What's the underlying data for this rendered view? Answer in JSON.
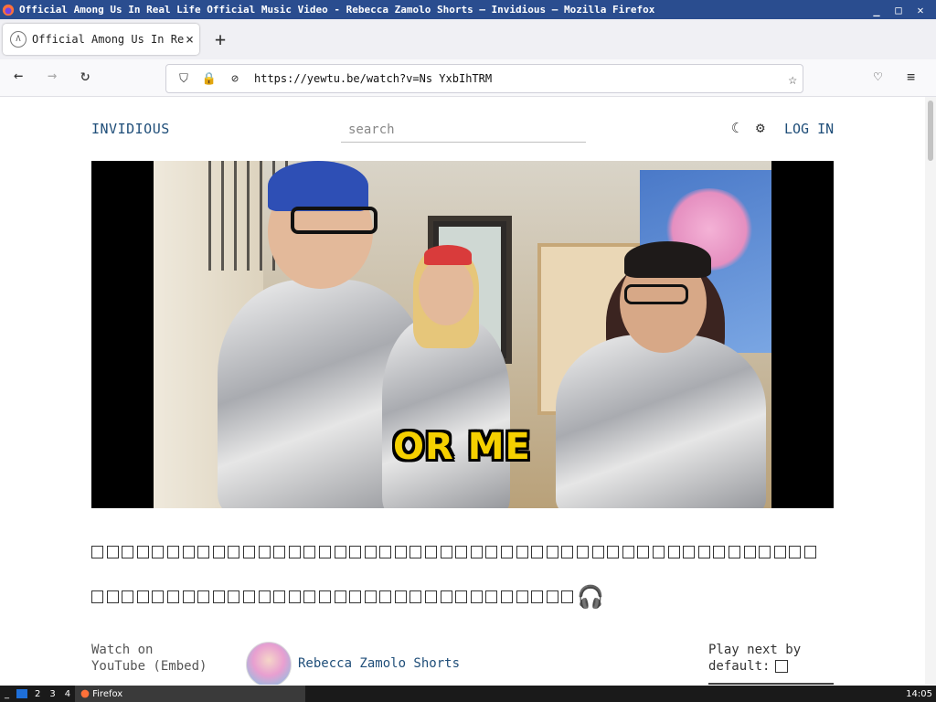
{
  "window": {
    "title": "Official Among Us In Real Life Official Music Video - Rebecca Zamolo Shorts — Invidious — Mozilla Firefox",
    "controls": [
      "_",
      "□",
      "✕"
    ]
  },
  "tabs": [
    {
      "title": "Official Among Us In Rea",
      "close": "×"
    }
  ],
  "newtab_label": "+",
  "nav": {
    "back": "←",
    "forward": "→",
    "reload": "↻",
    "url": "https://yewtu.be/watch?v=Ns  YxbIhTRM",
    "star": "☆",
    "pocket": "♡",
    "menu": "≡"
  },
  "site": {
    "logo": "INVIDIOUS",
    "search_placeholder": "search",
    "theme_icon": "☾",
    "settings_icon": "⚙",
    "login": "LOG IN"
  },
  "video": {
    "caption": "OR ME"
  },
  "info": {
    "title_glyph_count": 48,
    "description_glyph_count": 32,
    "headphones_icon": "🎧",
    "watch_on": "Watch on",
    "watch_on_2": "YouTube (Embed)",
    "channel": "Rebecca Zamolo Shorts",
    "play_next_1": "Play next by",
    "play_next_2": "default:"
  },
  "taskbar": {
    "start": "_",
    "workspaces": [
      "2",
      "3",
      "4"
    ],
    "app": "Firefox",
    "clock": "14:05"
  }
}
